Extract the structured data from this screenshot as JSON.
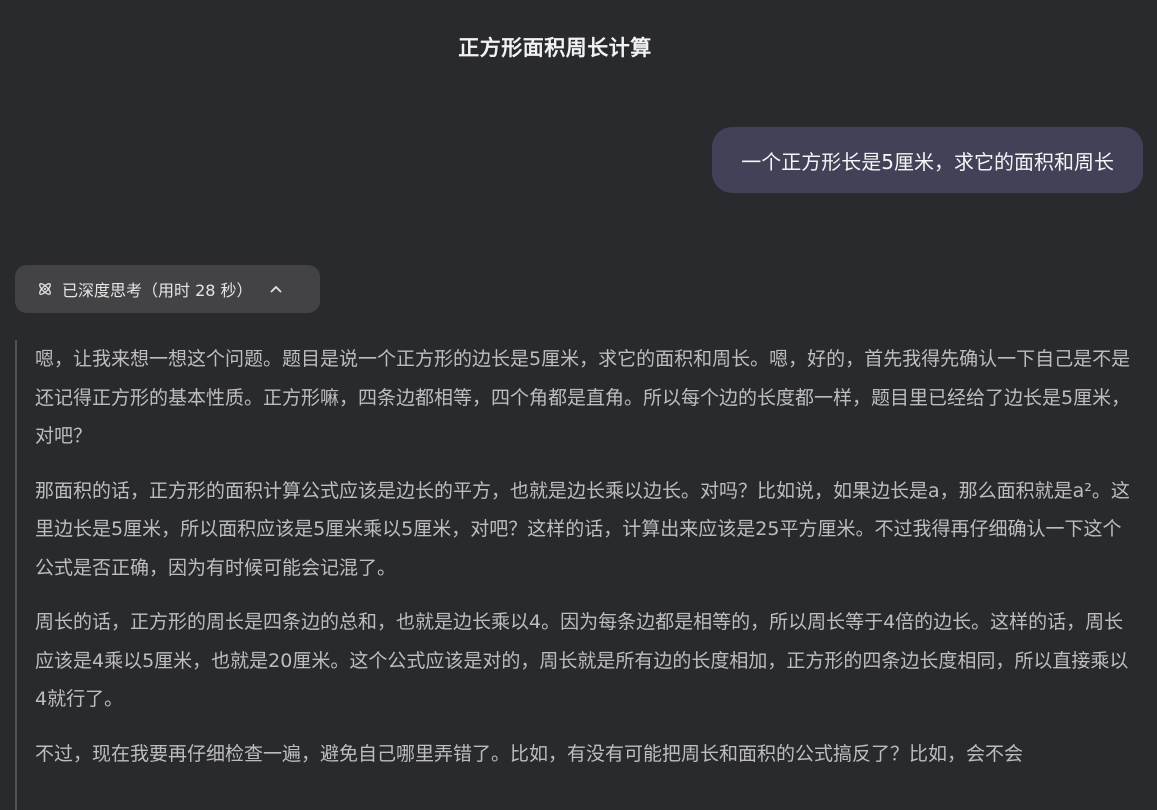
{
  "header": {
    "title": "正方形面积周长计算"
  },
  "user_message": {
    "text": "一个正方形长是5厘米，求它的面积和周长"
  },
  "thinking": {
    "toggle_label": "已深度思考（用时 28 秒）",
    "icon": "atom-icon",
    "chevron": "chevron-up-icon",
    "paragraphs": [
      "嗯，让我来想一想这个问题。题目是说一个正方形的边长是5厘米，求它的面积和周长。嗯，好的，首先我得先确认一下自己是不是还记得正方形的基本性质。正方形嘛，四条边都相等，四个角都是直角。所以每个边的长度都一样，题目里已经给了边长是5厘米，对吧？",
      "那面积的话，正方形的面积计算公式应该是边长的平方，也就是边长乘以边长。对吗？比如说，如果边长是a，那么面积就是a²。这里边长是5厘米，所以面积应该是5厘米乘以5厘米，对吧？这样的话，计算出来应该是25平方厘米。不过我得再仔细确认一下这个公式是否正确，因为有时候可能会记混了。",
      "周长的话，正方形的周长是四条边的总和，也就是边长乘以4。因为每条边都是相等的，所以周长等于4倍的边长。这样的话，周长应该是4乘以5厘米，也就是20厘米。这个公式应该是对的，周长就是所有边的长度相加，正方形的四条边长度相同，所以直接乘以4就行了。",
      "不过，现在我要再仔细检查一遍，避免自己哪里弄错了。比如，有没有可能把周长和面积的公式搞反了？比如，会不会"
    ]
  },
  "colors": {
    "background": "#292a2d",
    "user_bubble": "#414158",
    "toggle_bg": "#434345",
    "thinking_text": "#bdbdbd",
    "thinking_border": "#525256"
  }
}
